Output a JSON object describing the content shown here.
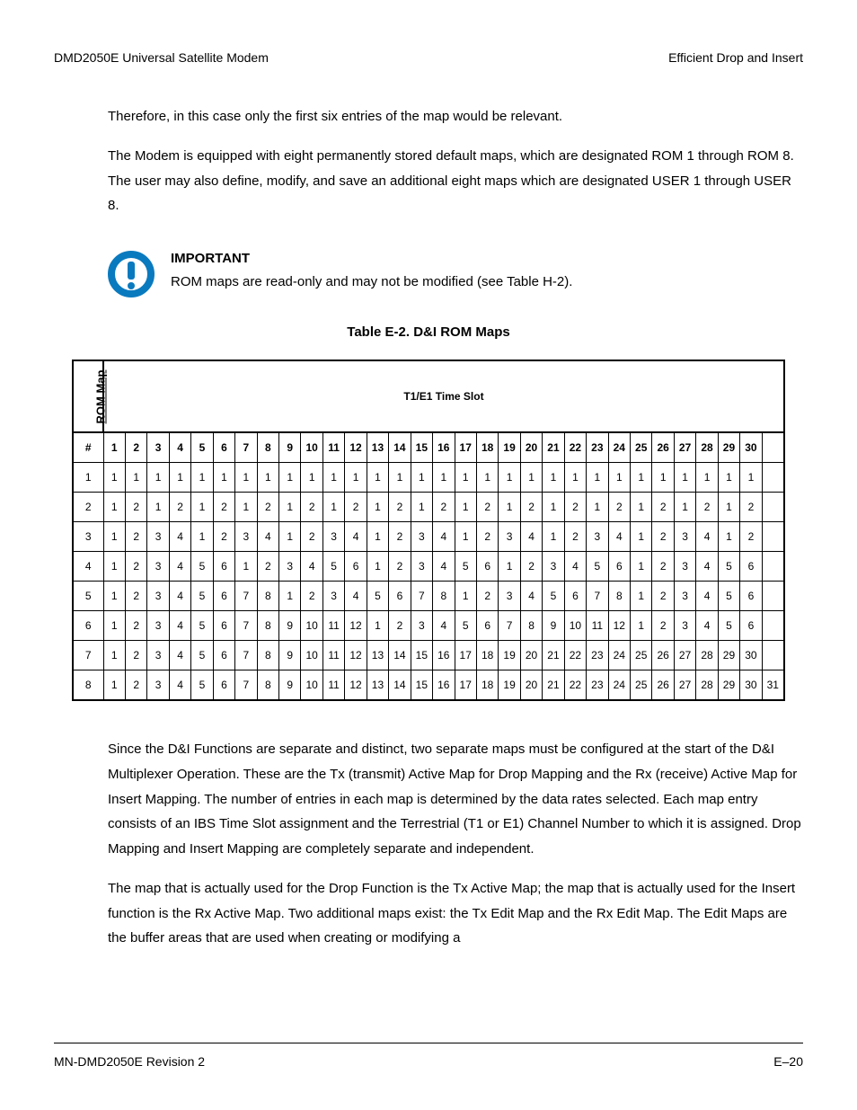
{
  "header": {
    "left": "DMD2050E Universal Satellite Modem",
    "right": "Efficient Drop and Insert"
  },
  "paragraphs": {
    "p1": "Therefore, in this case only the first six entries of the map would be relevant.",
    "p2": "The Modem is equipped with eight permanently stored default maps, which are designated ROM 1 through ROM 8.  The user may also define, modify, and save an additional eight maps which are designated USER 1 through USER 8.",
    "p3": "Since the D&I Functions are separate and distinct, two separate maps must be configured at the start of the D&I Multiplexer Operation.  These are the Tx (transmit) Active Map for Drop Mapping and the Rx (receive) Active Map for Insert Mapping.  The number of entries in each map is determined by the data rates selected.  Each map entry consists of an IBS Time Slot assignment and the Terrestrial (T1 or E1) Channel Number to which it is assigned.  Drop Mapping and Insert Mapping are completely separate and independent.",
    "p4": "The map that is actually used for the Drop Function is the Tx Active Map; the map that is actually used for the Insert function is the Rx Active Map.  Two additional maps exist: the Tx Edit Map and the Rx Edit Map.  The Edit Maps are the buffer areas that are used when creating or modifying a"
  },
  "note": {
    "title": "IMPORTANT",
    "text": "ROM maps are read-only and may not be modified (see Table H-2)."
  },
  "table": {
    "caption": "Table E-2.  D&I ROM Maps",
    "corner_label": "ROM Map",
    "span_label": "T1/E1 Time Slot",
    "hash": "#",
    "cols": [
      "1",
      "2",
      "3",
      "4",
      "5",
      "6",
      "7",
      "8",
      "9",
      "10",
      "11",
      "12",
      "13",
      "14",
      "15",
      "16",
      "17",
      "18",
      "19",
      "20",
      "21",
      "22",
      "23",
      "24",
      "25",
      "26",
      "27",
      "28",
      "29",
      "30"
    ],
    "rows": [
      {
        "num": "1",
        "cells": [
          "1",
          "1",
          "1",
          "1",
          "1",
          "1",
          "1",
          "1",
          "1",
          "1",
          "1",
          "1",
          "1",
          "1",
          "1",
          "1",
          "1",
          "1",
          "1",
          "1",
          "1",
          "1",
          "1",
          "1",
          "1",
          "1",
          "1",
          "1",
          "1",
          "1"
        ]
      },
      {
        "num": "2",
        "cells": [
          "1",
          "2",
          "1",
          "2",
          "1",
          "2",
          "1",
          "2",
          "1",
          "2",
          "1",
          "2",
          "1",
          "2",
          "1",
          "2",
          "1",
          "2",
          "1",
          "2",
          "1",
          "2",
          "1",
          "2",
          "1",
          "2",
          "1",
          "2",
          "1",
          "2"
        ]
      },
      {
        "num": "3",
        "cells": [
          "1",
          "2",
          "3",
          "4",
          "1",
          "2",
          "3",
          "4",
          "1",
          "2",
          "3",
          "4",
          "1",
          "2",
          "3",
          "4",
          "1",
          "2",
          "3",
          "4",
          "1",
          "2",
          "3",
          "4",
          "1",
          "2",
          "3",
          "4",
          "1",
          "2"
        ]
      },
      {
        "num": "4",
        "cells": [
          "1",
          "2",
          "3",
          "4",
          "5",
          "6",
          "1",
          "2",
          "3",
          "4",
          "5",
          "6",
          "1",
          "2",
          "3",
          "4",
          "5",
          "6",
          "1",
          "2",
          "3",
          "4",
          "5",
          "6",
          "1",
          "2",
          "3",
          "4",
          "5",
          "6"
        ]
      },
      {
        "num": "5",
        "cells": [
          "1",
          "2",
          "3",
          "4",
          "5",
          "6",
          "7",
          "8",
          "1",
          "2",
          "3",
          "4",
          "5",
          "6",
          "7",
          "8",
          "1",
          "2",
          "3",
          "4",
          "5",
          "6",
          "7",
          "8",
          "1",
          "2",
          "3",
          "4",
          "5",
          "6"
        ]
      },
      {
        "num": "6",
        "cells": [
          "1",
          "2",
          "3",
          "4",
          "5",
          "6",
          "7",
          "8",
          "9",
          "10",
          "11",
          "12",
          "1",
          "2",
          "3",
          "4",
          "5",
          "6",
          "7",
          "8",
          "9",
          "10",
          "11",
          "12",
          "1",
          "2",
          "3",
          "4",
          "5",
          "6"
        ]
      },
      {
        "num": "7",
        "cells": [
          "1",
          "2",
          "3",
          "4",
          "5",
          "6",
          "7",
          "8",
          "9",
          "10",
          "11",
          "12",
          "13",
          "14",
          "15",
          "16",
          "17",
          "18",
          "19",
          "20",
          "21",
          "22",
          "23",
          "24",
          "25",
          "26",
          "27",
          "28",
          "29",
          "30"
        ]
      },
      {
        "num": "8",
        "cells": [
          "1",
          "2",
          "3",
          "4",
          "5",
          "6",
          "7",
          "8",
          "9",
          "10",
          "11",
          "12",
          "13",
          "14",
          "15",
          "16",
          "17",
          "18",
          "19",
          "20",
          "21",
          "22",
          "23",
          "24",
          "25",
          "26",
          "27",
          "28",
          "29",
          "30",
          "31"
        ]
      }
    ]
  },
  "footer": {
    "left": "MN-DMD2050E   Revision 2",
    "right": "E–20"
  }
}
